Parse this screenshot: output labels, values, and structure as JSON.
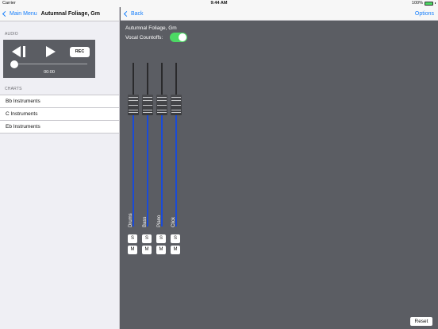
{
  "status_bar": {
    "carrier": "Carrier",
    "time": "9:44 AM",
    "battery": "100%",
    "battery_level": 1.0
  },
  "left_nav": {
    "back_label": "Main Menu",
    "title": "Autumnal Foliage, Gm"
  },
  "audio": {
    "section_header": "AUDIO",
    "rec_label": "REC",
    "time": "00:00",
    "progress": 0.0
  },
  "charts": {
    "section_header": "CHARTS",
    "items": [
      "Bb Instruments",
      "C Instruments",
      "Eb Instruments"
    ]
  },
  "right_nav": {
    "back_label": "Back",
    "options_label": "Options"
  },
  "mixer": {
    "song": "Autumnal Foliage, Gm",
    "countoff_label": "Vocal Countoffs:",
    "countoff_on": true,
    "channels": [
      {
        "name": "Drums",
        "solo": "S",
        "mute": "M",
        "level": 0.78
      },
      {
        "name": "Bass",
        "solo": "S",
        "mute": "M",
        "level": 0.78
      },
      {
        "name": "Piano",
        "solo": "S",
        "mute": "M",
        "level": 0.78
      },
      {
        "name": "Click",
        "solo": "S",
        "mute": "M",
        "level": 0.78
      }
    ],
    "reset_label": "Reset"
  },
  "colors": {
    "accent": "#157efb",
    "toggle_on": "#4cd964",
    "panel_bg": "#5b5d63",
    "fader_fill": "#1a4bd8"
  }
}
